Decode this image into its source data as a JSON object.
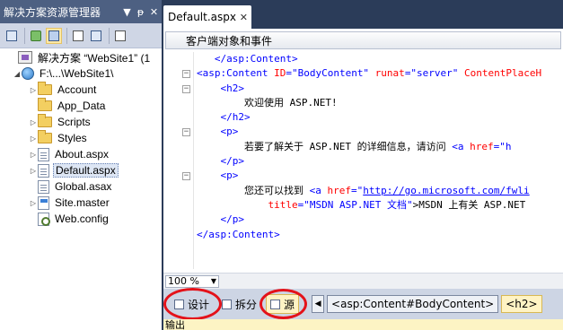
{
  "solution_explorer": {
    "title": "解决方案资源管理器",
    "title_buttons": {
      "dropdown": "▼",
      "pin": "ᵽ",
      "close": "✕"
    },
    "tree": [
      {
        "label": "解决方案 “WebSite1” (1",
        "icon": "solution-icon",
        "level": 0,
        "expander": ""
      },
      {
        "label": "F:\\...\\WebSite1\\",
        "icon": "website-icon",
        "level": 1,
        "expander": "◢"
      },
      {
        "label": "Account",
        "icon": "folder-icon",
        "level": 2,
        "expander": "▷"
      },
      {
        "label": "App_Data",
        "icon": "folder-icon",
        "level": 2,
        "expander": ""
      },
      {
        "label": "Scripts",
        "icon": "folder-icon",
        "level": 2,
        "expander": "▷"
      },
      {
        "label": "Styles",
        "icon": "folder-icon",
        "level": 2,
        "expander": "▷"
      },
      {
        "label": "About.aspx",
        "icon": "page-icon",
        "level": 2,
        "expander": "▷"
      },
      {
        "label": "Default.aspx",
        "icon": "page-icon",
        "level": 2,
        "expander": "▷",
        "selected": true
      },
      {
        "label": "Global.asax",
        "icon": "page-icon",
        "level": 2,
        "expander": ""
      },
      {
        "label": "Site.master",
        "icon": "master-icon",
        "level": 2,
        "expander": "▷"
      },
      {
        "label": "Web.config",
        "icon": "config-icon",
        "level": 2,
        "expander": ""
      }
    ]
  },
  "editor": {
    "tab_label": "Default.aspx",
    "tab_close": "✕",
    "object_dropdown": "客户端对象和事件",
    "zoom": "100 %",
    "code": {
      "l0": "</asp:Content>",
      "l1_a": "<asp:Content ",
      "l1_b": "ID",
      "l1_c": "=\"BodyContent\" ",
      "l1_d": "runat",
      "l1_e": "=\"server\" ",
      "l1_f": "ContentPlaceH",
      "l2": "<h2>",
      "l3": "欢迎使用 ASP.NET!",
      "l4": "</h2>",
      "l5": "<p>",
      "l6_a": "若要了解关于 ASP.NET 的详细信息，请访问 ",
      "l6_b": "<a ",
      "l6_c": "href",
      "l6_d": "=\"h",
      "l7": "</p>",
      "l8": "<p>",
      "l9_a": "您还可以找到 ",
      "l9_b": "<a ",
      "l9_c": "href",
      "l9_d": "=\"",
      "l9_e": "http://go.microsoft.com/fwli",
      "l10_a": "title",
      "l10_b": "=\"MSDN ASP.NET 文档\"",
      "l10_c": ">MSDN 上有关 ASP.NET",
      "l11": "</p>",
      "l12": "</asp:Content>"
    },
    "view_buttons": {
      "design": "设计",
      "split": "拆分",
      "source": "源"
    },
    "breadcrumbs": [
      "<asp:Content#BodyContent>",
      "<h2>"
    ],
    "output_label": "输出"
  }
}
